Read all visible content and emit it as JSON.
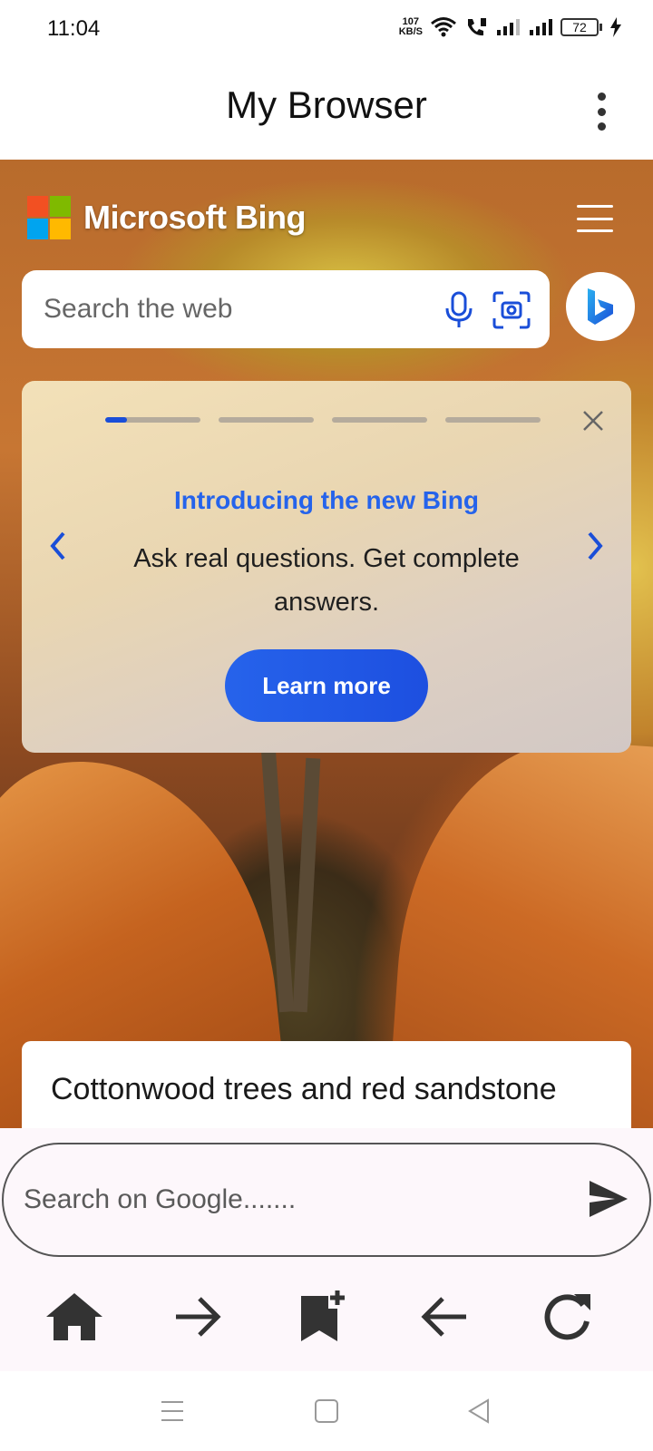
{
  "status_bar": {
    "time": "11:04",
    "net_speed_value": "107",
    "net_speed_unit": "KB/S",
    "battery_level": "72",
    "icons": [
      "wifi-icon",
      "volte-call-icon",
      "signal-sim1-icon",
      "signal-sim2-icon",
      "battery-icon",
      "charging-icon"
    ]
  },
  "app_bar": {
    "title": "My Browser",
    "menu_icon": "more-vert-icon"
  },
  "bing": {
    "brand": "Microsoft Bing",
    "search_placeholder": "Search the web",
    "icons": [
      "microsoft-logo-icon",
      "hamburger-menu-icon",
      "microphone-icon",
      "visual-search-icon",
      "copilot-bing-icon"
    ],
    "colors": {
      "accent": "#1a4ed8",
      "ms_red": "#f25022",
      "ms_green": "#7fba00",
      "ms_blue": "#00a4ef",
      "ms_yellow": "#ffb900"
    }
  },
  "promo_card": {
    "slide_count": 4,
    "active_slide_progress": 0.23,
    "heading": "Introducing the new Bing",
    "body": "Ask real questions. Get complete answers.",
    "button_label": "Learn more"
  },
  "caption": {
    "text": "Cottonwood trees and red sandstone"
  },
  "bottom_search": {
    "placeholder": "Search on Google.......",
    "send_icon": "send-icon"
  },
  "nav_bar": {
    "icons": [
      "home-icon",
      "forward-arrow-icon",
      "bookmark-add-icon",
      "back-arrow-icon",
      "refresh-icon"
    ]
  },
  "system_nav": {
    "icons": [
      "recents-icon",
      "home-square-icon",
      "back-triangle-icon"
    ]
  }
}
